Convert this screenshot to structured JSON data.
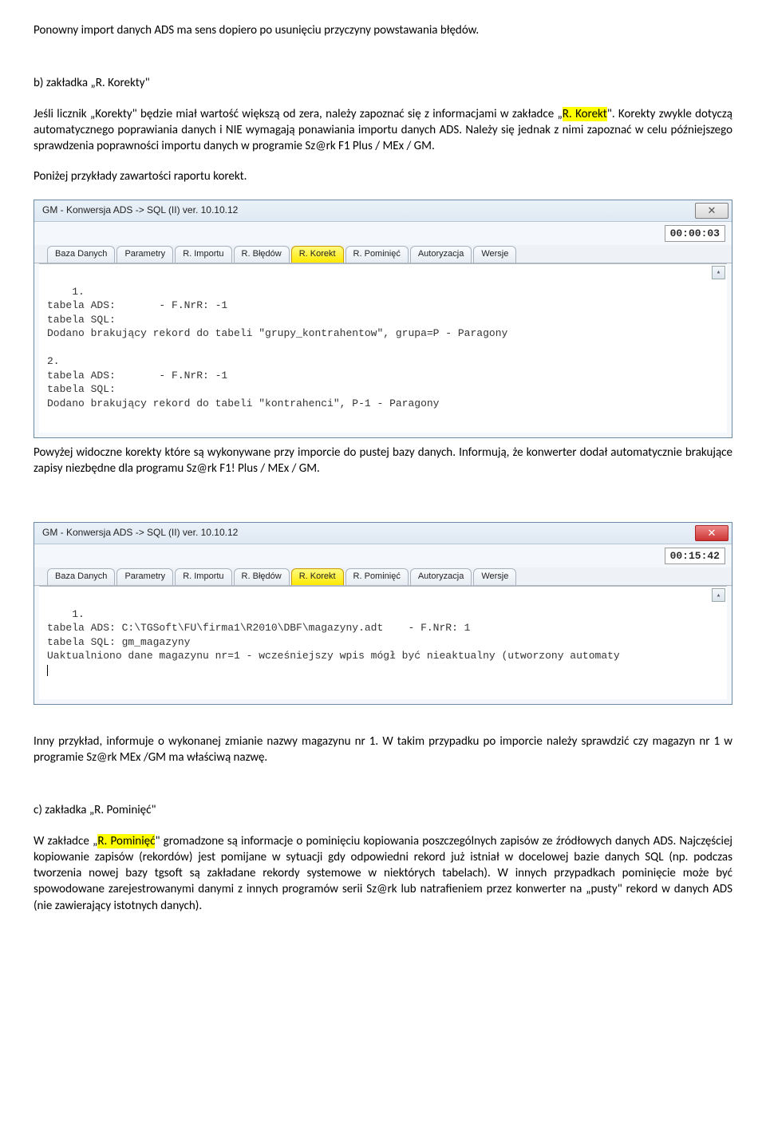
{
  "doc": {
    "p1": "Ponowny import danych ADS ma sens dopiero po usunięciu przyczyny powstawania błędów.",
    "h_b": "b) zakładka „R. Korekty\"",
    "p2a": "Jeśli licznik „Korekty\" będzie miał wartość większą od zera, należy zapoznać się z informacjami w zakładce „",
    "p2hl": "R. Korekt",
    "p2b": "\". Korekty zwykle dotyczą automatycznego poprawiania danych i NIE wymagają ponawiania importu danych ADS.  Należy się jednak z nimi zapoznać w celu późniejszego sprawdzenia poprawności importu danych w programie Sz@rk F1 Plus / MEx / GM.",
    "p3": "Poniżej przykłady zawartości raportu korekt.",
    "p4": "Powyżej widoczne korekty które są wykonywane przy imporcie do pustej bazy danych.  Informują, że konwerter dodał automatycznie brakujące zapisy  niezbędne dla programu Sz@rk F1! Plus / MEx / GM.",
    "p5": "Inny przykład, informuje o wykonanej zmianie nazwy magazynu nr 1.  W takim przypadku po imporcie należy sprawdzić czy magazyn nr 1 w programie Sz@rk MEx /GM ma właściwą nazwę.",
    "h_c": "c) zakładka „R. Pominięć\"",
    "p6a": "W zakładce „",
    "p6hl": "R. Pominięć",
    "p6b": "\"  gromadzone są informacje o pominięciu kopiowania poszczególnych zapisów ze źródłowych danych ADS.  Najczęściej kopiowanie zapisów (rekordów) jest pomijane w sytuacji gdy odpowiedni rekord już istniał w docelowej bazie danych SQL (np. podczas tworzenia nowej bazy tgsoft są zakładane rekordy systemowe w niektórych tabelach). W innych przypadkach pominięcie może być spowodowane zarejestrowanymi danymi z innych programów serii Sz@rk  lub natrafieniem przez konwerter na „pusty\" rekord w danych ADS (nie zawierający istotnych danych)."
  },
  "win1": {
    "title": "GM - Konwersja ADS  ->  SQL (II)     ver. 10.10.12",
    "timer": "00:00:03",
    "tabs": [
      "Baza Danych",
      "Parametry",
      "R. Importu",
      "R. Błędów",
      "R. Korekt",
      "R. Pominięć",
      "Autoryzacja",
      "Wersje"
    ],
    "activeTab": 4,
    "content": "1.\ntabela ADS:       - F.NrR: -1\ntabela SQL:\nDodano brakujący rekord do tabeli \"grupy_kontrahentow\", grupa=P - Paragony\n\n2.\ntabela ADS:       - F.NrR: -1\ntabela SQL:\nDodano brakujący rekord do tabeli \"kontrahenci\", P-1 - Paragony",
    "closeStyle": "plain",
    "closeGlyph": "✕"
  },
  "win2": {
    "title": "GM - Konwersja ADS  ->  SQL (II)     ver. 10.10.12",
    "timer": "00:15:42",
    "tabs": [
      "Baza Danych",
      "Parametry",
      "R. Importu",
      "R. Błędów",
      "R. Korekt",
      "R. Pominięć",
      "Autoryzacja",
      "Wersje"
    ],
    "activeTab": 4,
    "content": "1.\ntabela ADS: C:\\TGSoft\\FU\\firma1\\R2010\\DBF\\magazyny.adt    - F.NrR: 1\ntabela SQL: gm_magazyny\nUaktualniono dane magazynu nr=1 - wcześniejszy wpis mógł być nieaktualny (utworzony automaty",
    "closeStyle": "red",
    "closeGlyph": "✕"
  }
}
